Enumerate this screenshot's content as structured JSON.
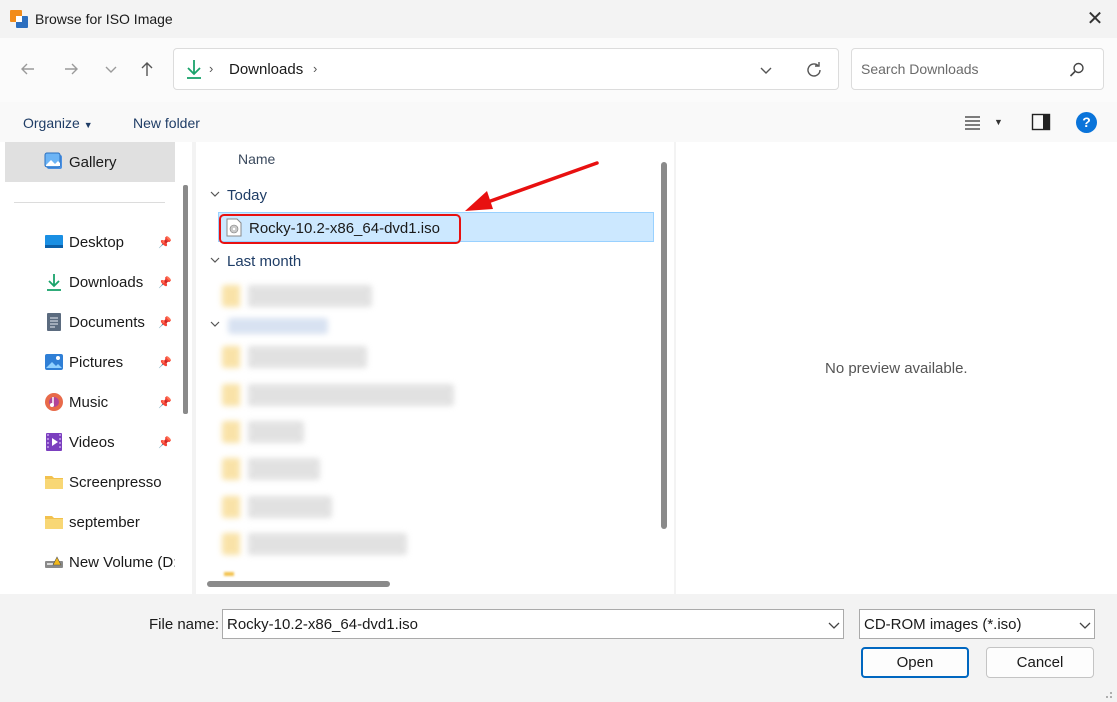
{
  "window": {
    "title": "Browse for ISO Image"
  },
  "address": {
    "location": "Downloads"
  },
  "search": {
    "placeholder": "Search Downloads"
  },
  "toolbar": {
    "organize": "Organize",
    "new_folder": "New folder"
  },
  "sidebar": {
    "gallery": "Gallery",
    "items": [
      {
        "label": "Desktop",
        "icon": "desktop-icon",
        "pinned": true
      },
      {
        "label": "Downloads",
        "icon": "download-icon",
        "pinned": true
      },
      {
        "label": "Documents",
        "icon": "documents-icon",
        "pinned": true
      },
      {
        "label": "Pictures",
        "icon": "pictures-icon",
        "pinned": true
      },
      {
        "label": "Music",
        "icon": "music-icon",
        "pinned": true
      },
      {
        "label": "Videos",
        "icon": "videos-icon",
        "pinned": true
      },
      {
        "label": "Screenpresso",
        "icon": "folder-icon",
        "pinned": false
      },
      {
        "label": "september",
        "icon": "folder-icon",
        "pinned": false
      },
      {
        "label": "New Volume (D:",
        "icon": "drive-icon",
        "pinned": false
      }
    ]
  },
  "file_list": {
    "column_name": "Name",
    "groups": [
      {
        "label": "Today",
        "files": [
          {
            "name": "Rocky-10.2-x86_64-dvd1.iso",
            "selected": true
          }
        ]
      },
      {
        "label": "Last month",
        "files": []
      }
    ]
  },
  "preview": {
    "message": "No preview available."
  },
  "footer": {
    "file_name_label": "File name:",
    "file_name_value": "Rocky-10.2-x86_64-dvd1.iso",
    "file_type": "CD-ROM images (*.iso)",
    "open": "Open",
    "cancel": "Cancel"
  },
  "colors": {
    "accent": "#0067c0",
    "selection": "#cce8ff",
    "annotation": "#e81010"
  }
}
